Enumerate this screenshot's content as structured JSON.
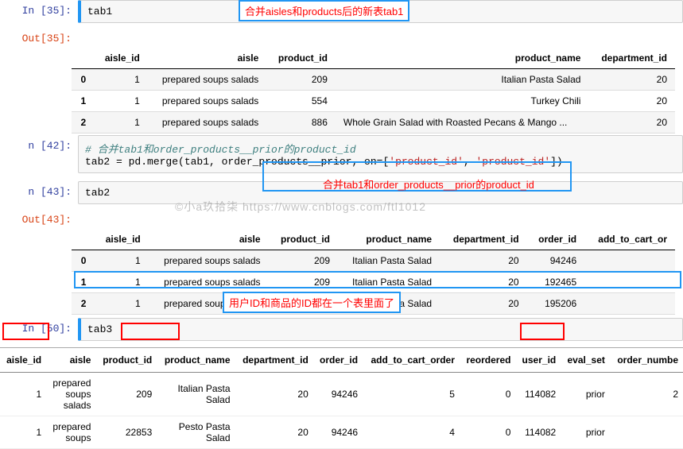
{
  "cell1": {
    "prompt": "In [35]:",
    "code": "tab1"
  },
  "anno1": "合并aisles和products后的新表tab1",
  "out1": {
    "prompt": "Out[35]:"
  },
  "tab1": {
    "columns": [
      "aisle_id",
      "aisle",
      "product_id",
      "product_name",
      "department_id"
    ],
    "rows": [
      {
        "idx": "0",
        "aisle_id": "1",
        "aisle": "prepared soups salads",
        "product_id": "209",
        "product_name": "Italian Pasta Salad",
        "department_id": "20"
      },
      {
        "idx": "1",
        "aisle_id": "1",
        "aisle": "prepared soups salads",
        "product_id": "554",
        "product_name": "Turkey Chili",
        "department_id": "20"
      },
      {
        "idx": "2",
        "aisle_id": "1",
        "aisle": "prepared soups salads",
        "product_id": "886",
        "product_name": "Whole Grain Salad with Roasted Pecans & Mango ...",
        "department_id": "20"
      }
    ]
  },
  "cell2": {
    "prompt": "n [42]:",
    "comment": "# 合并tab1和order_products__prior的product_id",
    "line2_a": "tab2 = pd.merge(tab1, order_products__prior, on=[",
    "str1": "'product_id'",
    "sep": ", ",
    "str2": "'product_id'",
    "line2_b": "])"
  },
  "cell3": {
    "prompt": "n [43]:",
    "code": "tab2"
  },
  "anno2": "合并tab1和order_products__prior的product_id",
  "watermark": "©小a玖拾柒  https://www.cnblogs.com/ftl1012",
  "out3": {
    "prompt": "Out[43]:"
  },
  "tab2": {
    "columns": [
      "aisle_id",
      "aisle",
      "product_id",
      "product_name",
      "department_id",
      "order_id",
      "add_to_cart_or"
    ],
    "rows": [
      {
        "idx": "0",
        "aisle_id": "1",
        "aisle": "prepared soups salads",
        "product_id": "209",
        "product_name": "Italian Pasta Salad",
        "department_id": "20",
        "order_id": "94246",
        "atc": ""
      },
      {
        "idx": "1",
        "aisle_id": "1",
        "aisle": "prepared soups salads",
        "product_id": "209",
        "product_name": "Italian Pasta Salad",
        "department_id": "20",
        "order_id": "192465",
        "atc": ""
      },
      {
        "idx": "2",
        "aisle_id": "1",
        "aisle": "prepared soups salads",
        "product_id": "209",
        "product_name": "Italian Pasta Salad",
        "department_id": "20",
        "order_id": "195206",
        "atc": ""
      }
    ]
  },
  "cell4": {
    "prompt": "In [50]:",
    "code": "tab3"
  },
  "anno3": "用户ID和商品的ID都在一个表里面了",
  "tab3": {
    "columns": [
      "aisle_id",
      "aisle",
      "product_id",
      "product_name",
      "department_id",
      "order_id",
      "add_to_cart_order",
      "reordered",
      "user_id",
      "eval_set",
      "order_numbe"
    ],
    "rows": [
      {
        "aisle_id": "1",
        "aisle": "prepared\nsoups\nsalads",
        "product_id": "209",
        "product_name": "Italian Pasta\nSalad",
        "department_id": "20",
        "order_id": "94246",
        "atc": "5",
        "reordered": "0",
        "user_id": "114082",
        "eval_set": "prior",
        "onum": "2"
      },
      {
        "aisle_id": "1",
        "aisle": "prepared\nsoups",
        "product_id": "22853",
        "product_name": "Pesto Pasta\nSalad",
        "department_id": "20",
        "order_id": "94246",
        "atc": "4",
        "reordered": "0",
        "user_id": "114082",
        "eval_set": "prior",
        "onum": ""
      }
    ]
  }
}
